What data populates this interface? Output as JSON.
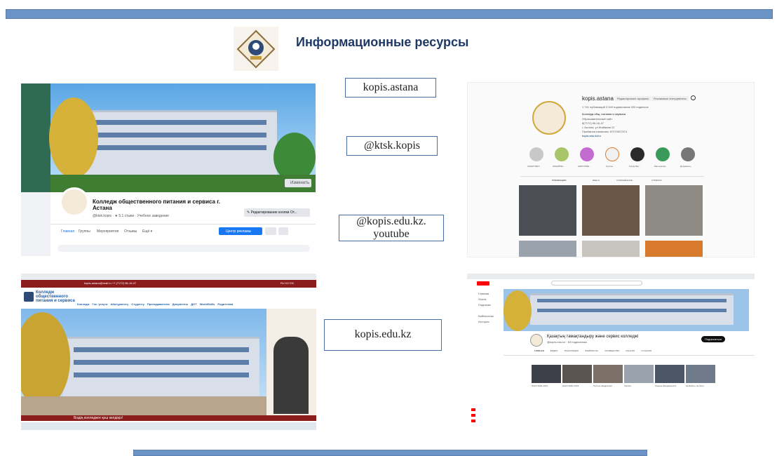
{
  "slide": {
    "title": "Информационные ресурсы"
  },
  "labels": {
    "instagram": "kopis.astana",
    "facebook": "@ktsk.kopis",
    "youtube_line1": "@kopis.edu.kz.",
    "youtube_line2": "youtube",
    "website": "kopis.edu.kz"
  },
  "facebook_page": {
    "name_line1": "Колледж общественного питания и сервиса г.",
    "name_line2": "Астана",
    "meta": "@ktsk.kopis · ★ 5.1 стыки · Учебное заведение",
    "edit_cover": "Изменить",
    "edit_button": "✎ Редактирование кнопки От...",
    "tabs": [
      "Главная",
      "Группы",
      "Мероприятия",
      "Отзывы",
      "Ещё ▾"
    ],
    "ad_button": "Центр рекламы"
  },
  "instagram_page": {
    "username": "kopis.astana",
    "edit_profile": "Редактировать профиль",
    "ad_tools": "Рекламные инструменты",
    "stats": "1 741 публикаций   3 349 подписчиков   320 подписок",
    "bio_name": "Колледж общ. питания и сервиса",
    "bio_lines": [
      "Образовательный сайт",
      "8(7172) 56-16-47",
      "г. Астана, ул.Жабаева 12",
      "Приёмная комиссия: 87079027574",
      "kopis.edu.kz/ru"
    ],
    "highlights": [
      "СМАРТ-ВЕТ...",
      "АРНАЙЛЫ...",
      "АБИТУРИЕ...",
      "Группы",
      "Kunde Вет...",
      "Мастерклас",
      "Документы"
    ],
    "tabs": [
      "ПУБЛИКАЦИИ",
      "REELS",
      "СОХРАНЁННОЕ",
      "ОТМЕТКИ"
    ]
  },
  "website_page": {
    "topbar_left": "kopis-astana@mail.ru   +7 (7172) 56-16-47",
    "topbar_right": "RU  KZ  EN",
    "logo_text": [
      "Колледж",
      "общественного",
      "питания и сервиса"
    ],
    "nav": [
      "Колледж",
      "Гос. услуги",
      "Абитуриенту",
      "Студенту",
      "Преподавателю",
      "Документы",
      "ДОТ",
      "WorldSkills",
      "Родителям"
    ],
    "banner_text": "Біздің колледжге қош келдіңіз!"
  },
  "youtube_page": {
    "channel_name": "Қазақтың тамақтандыру және сервис колледжі",
    "channel_meta": "@kopis.edu.kz · 83 подписчика",
    "subscribe": "Подписаться",
    "tabs": [
      "ГЛАВНАЯ",
      "ВИДЕО",
      "ТРАНСЛЯЦИИ",
      "ПЛЕЙЛИСТЫ",
      "СООБЩЕСТВО",
      "КАНАЛЫ",
      "О КАНАЛЕ"
    ],
    "sidebar": [
      "Главная",
      "Shorts",
      "Подписки",
      "Библиотека",
      "История"
    ],
    "videos": [
      "World Skills 2021",
      "World Skills 2019",
      "Пустые квадратики",
      "Удобно",
      "Лидеры Выдающихся",
      "Ак Байлы, Ақ Кесу..."
    ]
  }
}
